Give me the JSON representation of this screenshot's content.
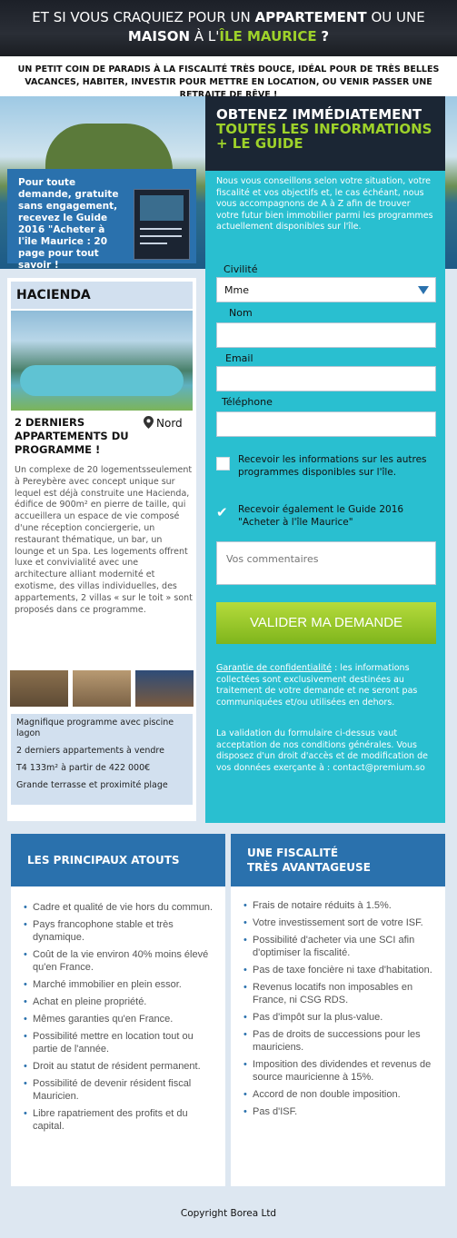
{
  "banner": {
    "line1_pre": "ET SI VOUS CRAQUIEZ POUR UN",
    "line1_bold": "APPARTEMENT",
    "line1_post": "OU UNE",
    "line2_bold": "MAISON",
    "line2_mid": "À L'",
    "line2_hl": "ÎLE MAURICE",
    "line2_post": "?"
  },
  "tagline": "UN PETIT COIN DE PARADIS À LA FISCALITÉ TRÈS DOUCE, IDÉAL POUR DE TRÈS BELLES VACANCES, HABITER, INVESTIR POUR METTRE EN LOCATION, OU VENIR PASSER UNE RETRAITE DE RÊVE !",
  "promo": {
    "text": "Pour toute demande, gratuite sans engagement, recevez le Guide 2016 \"Acheter à l'île Maurice : 20 page pour tout savoir !"
  },
  "program": {
    "title": "HACIENDA",
    "subtitle": "2 DERNIERS APPARTEMENTS DU PROGRAMME !",
    "location": "Nord",
    "description": "Un complexe de 20 logementsseulement à Pereybère avec concept unique sur lequel est déjà construite une Hacienda, édifice de 900m² en pierre de taille, qui accueillera un espace de vie composé d'une réception conciergerie, un restaurant thématique, un bar, un lounge et un Spa. Les logements offrent luxe et convivialité avec une architecture alliant modernité et exotisme, des villas individuelles, des appartements, 2 villas « sur le toit » sont proposés dans ce programme.",
    "features": [
      "Magnifique programme avec piscine lagon",
      "2 derniers appartements à vendre",
      "T4 133m² à partir de 422 000€",
      "Grande terrasse et proximité plage"
    ]
  },
  "form": {
    "heading_white": "OBTENEZ IMMÉDIATEMENT",
    "heading_green": "TOUTES LES INFORMATIONS + LE GUIDE",
    "intro": "Nous vous conseillons selon votre situation, votre fiscalité et vos objectifs et, le cas échéant, nous vous accompagnons de A à Z afin de trouver votre futur bien immobilier parmi les programmes actuellement disponibles sur l'île.",
    "civility_label": "Civilité",
    "civility_value": "Mme",
    "name_label": "Nom",
    "email_label": "Email",
    "phone_label": "Téléphone",
    "checkbox1": "Recevoir les informations sur les autres programmes disponibles sur l'île.",
    "checkbox2": "Recevoir également le Guide 2016 \"Acheter à l'île Maurice\"",
    "comments_placeholder": "Vos commentaires",
    "submit": "VALIDER MA DEMANDE",
    "privacy_link": "Garantie de confidentialité",
    "privacy_text": ": les informations collectées sont exclusivement destinées au traitement de votre demande et ne seront pas communiquées et/ou utilisées en dehors.",
    "legal": "La validation du formulaire ci-dessus vaut acceptation de nos conditions générales. Vous disposez d'un droit d'accès et de modification de vos données exerçante à : contact@premium.so"
  },
  "atouts": {
    "title": "LES PRINCIPAUX ATOUTS",
    "items": [
      "Cadre et qualité de vie hors du commun.",
      "Pays francophone stable et très dynamique.",
      "Coût de la vie environ 40% moins élevé qu'en France.",
      "Marché immobilier en plein essor.",
      "Achat en pleine propriété.",
      "Mêmes garanties qu'en France.",
      "Possibilité mettre en location tout ou partie de l'année.",
      "Droit au statut de résident permanent.",
      "Possibilité de devenir résident fiscal Mauricien.",
      "Libre rapatriement des profits et du capital."
    ]
  },
  "fiscalite": {
    "title_line1": "UNE FISCALITÉ",
    "title_line2": "TRÈS AVANTAGEUSE",
    "items": [
      "Frais de notaire réduits à 1.5%.",
      "Votre investissement sort de votre ISF.",
      "Possibilité d'acheter via une SCI afin d'optimiser la fiscalité.",
      "Pas de taxe foncière ni taxe d'habitation.",
      "Revenus locatifs non imposables en France, ni CSG RDS.",
      "Pas d'impôt sur la plus-value.",
      "Pas de droits de successions pour les mauriciens.",
      "Imposition des dividendes et revenus de source mauricienne à 15%.",
      "Accord de non double imposition.",
      "Pas d'ISF."
    ]
  },
  "footer": "Copyright Borea Ltd"
}
